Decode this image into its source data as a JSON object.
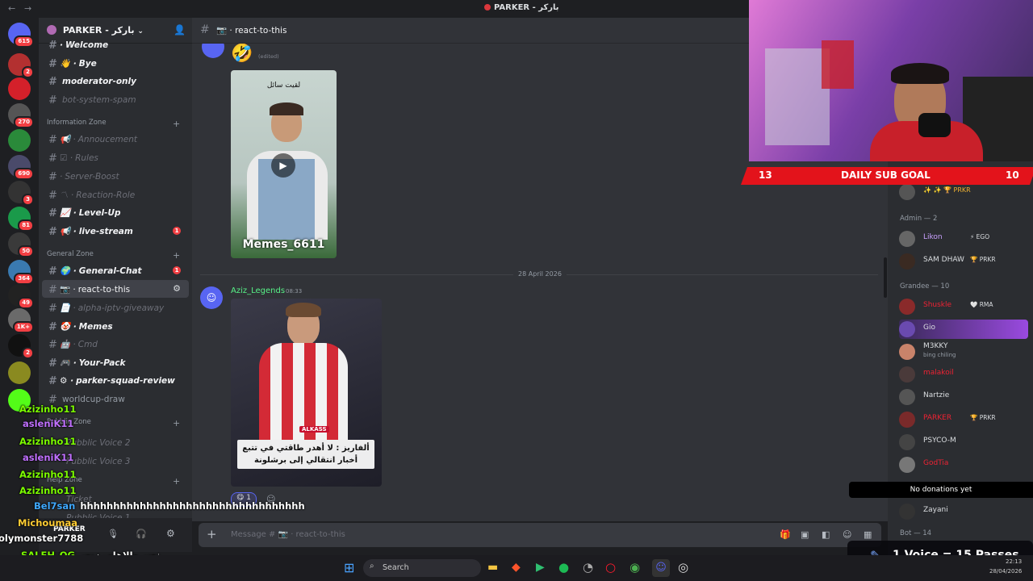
{
  "window": {
    "title": "PARKER - باركر",
    "back": "←",
    "forward": "→"
  },
  "server": {
    "name": "PARKER - باركر"
  },
  "server_rail": [
    {
      "badge": "615",
      "color": "#5865f2"
    },
    {
      "badge": "2",
      "color": "#b33030"
    },
    {
      "badge": "",
      "color": "#d4202a"
    },
    {
      "badge": "270",
      "color": "#555"
    },
    {
      "badge": "",
      "color": "#2a8a3a"
    },
    {
      "badge": "690",
      "color": "#4a4a6a"
    },
    {
      "badge": "3",
      "color": "#333"
    },
    {
      "badge": "81",
      "color": "#1a9a4a"
    },
    {
      "badge": "50",
      "color": "#3a3a3a"
    },
    {
      "badge": "364",
      "color": "#3a7ab0"
    },
    {
      "badge": "49",
      "color": "#222"
    },
    {
      "badge": "1K+",
      "color": "#6a6a6a"
    },
    {
      "badge": "2",
      "color": "#111"
    },
    {
      "badge": "",
      "color": "#8a8a20"
    },
    {
      "badge": "",
      "color": "#53fc18"
    }
  ],
  "channels": [
    {
      "name": "Welcome",
      "emoji": "·",
      "state": "unread",
      "badge": ""
    },
    {
      "name": "Bye",
      "emoji": "👋 ·",
      "state": "unread",
      "badge": ""
    },
    {
      "name": "moderator-only",
      "emoji": "",
      "state": "unread",
      "badge": ""
    },
    {
      "name": "bot-system-spam",
      "emoji": "",
      "state": "muted",
      "badge": ""
    },
    {
      "name": "Annoucement",
      "emoji": "📢 ·",
      "state": "muted",
      "badge": ""
    },
    {
      "name": "Rules",
      "emoji": "☑ ·",
      "state": "muted",
      "badge": ""
    },
    {
      "name": "Server-Boost",
      "emoji": "·",
      "state": "muted",
      "badge": ""
    },
    {
      "name": "Reaction-Role",
      "emoji": "〽 ·",
      "state": "muted",
      "badge": ""
    },
    {
      "name": "Level-Up",
      "emoji": "📈 ·",
      "state": "unread",
      "badge": ""
    },
    {
      "name": "live-stream",
      "emoji": "📢 ·",
      "state": "unread",
      "badge": "1"
    },
    {
      "name": "General-Chat",
      "emoji": "🌍 ·",
      "state": "unread",
      "badge": "1"
    },
    {
      "name": "react-to-this",
      "emoji": "📷 ·",
      "state": "active",
      "badge": ""
    },
    {
      "name": "alpha-iptv-giveaway",
      "emoji": "📄 ·",
      "state": "muted",
      "badge": ""
    },
    {
      "name": "Memes",
      "emoji": "🤡 ·",
      "state": "unread",
      "badge": ""
    },
    {
      "name": "Cmd",
      "emoji": "🤖 ·",
      "state": "muted",
      "badge": ""
    },
    {
      "name": "Your-Pack",
      "emoji": "🎮 ·",
      "state": "unread",
      "badge": ""
    },
    {
      "name": "parker-squad-review",
      "emoji": "⚙ ·",
      "state": "unread",
      "badge": ""
    },
    {
      "name": "worldcup-draw",
      "emoji": "",
      "state": "normal",
      "badge": ""
    }
  ],
  "categories": {
    "info": "Information Zone",
    "general": "General Zone",
    "voice": "Pubblic Zone",
    "help": "Help Zone"
  },
  "voice_channels": [
    "Pubblic Voice 2",
    "Pubblic Voice 3",
    "Pubblic Voice 1",
    "Ticket"
  ],
  "chat": {
    "channel": "react-to-this",
    "edited": "(edited)",
    "date_divider": "28 April 2026",
    "author": "Aziz_Legends",
    "time": "08:33",
    "meme_caption": "لقيت سائل",
    "meme_watermark": "Memes_6611",
    "photo_caption": "ألفاريز : لا أهدر طاقتي في تتبع أخبار انتقالي إلى برشلونة",
    "photo_tag": "ALKASS",
    "reaction_count": "1",
    "composer_placeholder": "Message # 📷 · react-to-this"
  },
  "user": {
    "name": "PARKER"
  },
  "overlay": {
    "subgoal_left": "13",
    "subgoal_title": "DAILY SUB GOAL",
    "subgoal_right": "10",
    "donations": "No donations yet",
    "voice_promo": "1 Voice = 15 Passes",
    "clock_time": "22:13",
    "clock_date": "28/04/2026"
  },
  "members": {
    "top_tag": "PRKR",
    "roles": [
      {
        "label": "Admin — 2"
      },
      {
        "label": "Grandee — 10"
      },
      {
        "label": "Bot — 14"
      }
    ],
    "list": [
      {
        "name": "Likon",
        "tag": "⚡ EGO",
        "color": "#c9a0ff"
      },
      {
        "name": "SAM DHAW",
        "tag": "🏆 PRKR",
        "color": "#dbdee1"
      },
      {
        "name": "Shuskle",
        "tag": "🤍 RMA",
        "color": "#e23"
      },
      {
        "name": "Gio",
        "tag": "",
        "color": "#dbdee1"
      },
      {
        "name": "M3KKY",
        "tag": "",
        "status": "bing chiling",
        "color": "#dbdee1"
      },
      {
        "name": "malakoil",
        "tag": "",
        "color": "#e23"
      },
      {
        "name": "Nartzie",
        "tag": "",
        "color": "#dbdee1"
      },
      {
        "name": "PARKER",
        "tag": "🏆 PRKR",
        "color": "#e23"
      },
      {
        "name": "PSYCO-M",
        "tag": "",
        "color": "#dbdee1"
      },
      {
        "name": "GodTia",
        "tag": "",
        "color": "#e23"
      },
      {
        "name": "Zayani",
        "tag": "",
        "color": "#dbdee1"
      }
    ]
  },
  "stream_chat": [
    {
      "user": "Azizinho11",
      "msg": "",
      "color": "#7cfc00"
    },
    {
      "user": "asleniK11",
      "msg": "",
      "color": "#c070ff"
    },
    {
      "user": "Azizinho11",
      "msg": "",
      "color": "#7cfc00"
    },
    {
      "user": "asleniK11",
      "msg": "",
      "color": "#c070ff"
    },
    {
      "user": "Azizinho11",
      "msg": "",
      "color": "#7cfc00"
    },
    {
      "user": "Azizinho11",
      "msg": "",
      "color": "#7cfc00"
    },
    {
      "user": "Bel7san",
      "msg": "hhhhhhhhhhhhhhhhhhhhhhhhhhhhhhhhhh",
      "color": "#3fa9ff"
    },
    {
      "user": "Michoumaa",
      "msg": "",
      "color": "#ffcc33"
    },
    {
      "user": "olymonster7788",
      "msg": "",
      "color": "#ffffff"
    },
    {
      "user": "SALEH_OG",
      "msg": "نصر والاهلي زيور",
      "color": "#7cfc00"
    },
    {
      "user": "Bel7san",
      "msg": "hhhhhhhhhhhhhhhhhhhhhhhhhhhhhhhhhhhhhhhh",
      "color": "#3fa9ff"
    }
  ],
  "taskbar": {
    "search": "Search"
  }
}
